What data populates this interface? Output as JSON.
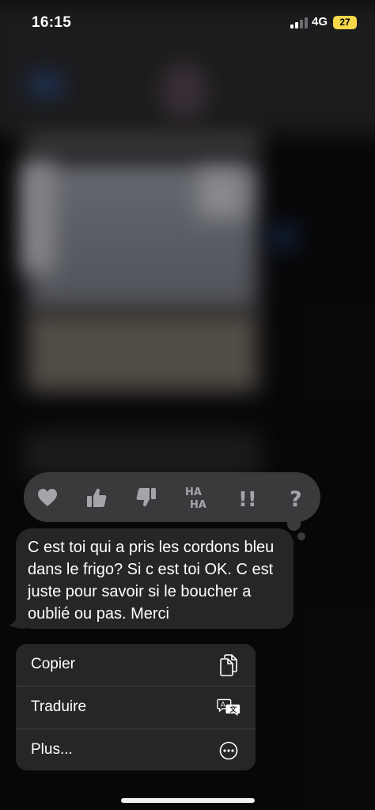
{
  "status_bar": {
    "time": "16:15",
    "network": "4G",
    "battery": "27",
    "battery_color": "#f6d84a"
  },
  "reactions": [
    {
      "name": "heart",
      "icon": "heart-icon"
    },
    {
      "name": "thumbs-up",
      "icon": "thumbs-up-icon"
    },
    {
      "name": "thumbs-down",
      "icon": "thumbs-down-icon"
    },
    {
      "name": "haha",
      "icon": "haha-icon",
      "label_top": "HA",
      "label_bottom": "HA"
    },
    {
      "name": "emphasize",
      "icon": "double-exclamation-icon",
      "label": "!!"
    },
    {
      "name": "question",
      "icon": "question-mark-icon",
      "label": "?"
    }
  ],
  "message": {
    "text": "C est toi qui a pris les cordons bleu dans le frigo? Si c est toi OK. C est juste pour savoir si le boucher a oublié ou pas. Merci"
  },
  "menu": {
    "items": [
      {
        "label": "Copier",
        "icon": "copy-icon"
      },
      {
        "label": "Traduire",
        "icon": "translate-icon"
      },
      {
        "label": "Plus...",
        "icon": "more-icon"
      }
    ]
  },
  "colors": {
    "reaction_bar": "#3a3a3d",
    "bubble": "#262628",
    "menu": "#262628",
    "icon_grey": "#9c9ca1"
  }
}
